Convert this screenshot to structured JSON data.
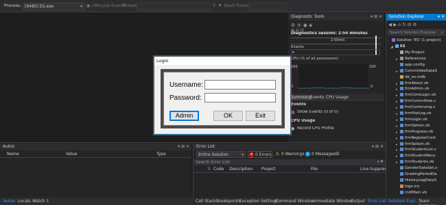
{
  "toolbar": {
    "process_label": "Process:",
    "process_value": "[9480] ES.exe",
    "lifecycle_label": "Lifecycle Events",
    "thread_label": "Thread:",
    "stack_frame_label": "Stack Frame:"
  },
  "diagnostic_tools": {
    "title": "Diagnostic Tools",
    "session_label": "Diagnostics session: 2:54 minutes",
    "timeline_label": "2:50min",
    "events_section": "Events",
    "cpu_section": "CPU (% of all processors)",
    "cpu_max_left": "100",
    "cpu_max_right": "100",
    "cpu_min_left": "0",
    "cpu_min_right": "0",
    "tabs": [
      "Summary",
      "Events",
      "CPU Usage"
    ],
    "events_heading": "Events",
    "show_events": "Show Events (0 of 0)",
    "cpu_usage_heading": "CPU Usage",
    "record_cpu": "Record CPU Profile"
  },
  "solution_explorer": {
    "title": "Solution Explorer",
    "search_placeholder": "Search Solution Explorer (",
    "solution": "Solution 'ES' (1 project)",
    "project": "ES",
    "items": [
      "My Project",
      "References",
      "app.config",
      "CommitteeDataS",
      "db_es.mdb",
      "frmAbout.vb",
      "frmAdmin.vb",
      "frmComLogin.vb",
      "frmCommittee.v",
      "frmContinuing.v",
      "frmHistLog.vb",
      "frmLogin.vb",
      "frmOption.vb",
      "frmProgress.vb",
      "frmRegisterCont",
      "frmSplash.vb",
      "frmStudentList.v",
      "frmStudentReco",
      "frmStudents.vb",
      "GenderDataSet.x",
      "GradingPeriodDa",
      "HistoryLogDataS",
      "logo.ico",
      "mdiMain.vb"
    ],
    "bottom_tabs": [
      "Solution Expl...",
      "Team Explorer"
    ]
  },
  "autos": {
    "title": "Autos",
    "columns": [
      "Name",
      "Value",
      "Type"
    ],
    "bottom_tabs": [
      "Autos",
      "Locals",
      "Watch 1"
    ]
  },
  "error_list": {
    "title": "Error List",
    "scope": "Entire Solution",
    "errors": "0 Errors",
    "warnings": "0 Warnings",
    "messages": "0 Messages",
    "search_placeholder": "Search Error List",
    "columns": [
      "Code",
      "Description",
      "Project",
      "File",
      "Line",
      "Suppres"
    ],
    "bottom_tabs": [
      "Call Stack",
      "Breakpoints",
      "Exception Settings",
      "Command Window",
      "Immediate Window",
      "Output",
      "Error List"
    ]
  },
  "login_dialog": {
    "title": "Login",
    "username_label": "Username:",
    "password_label": "Password:",
    "username_value": "",
    "password_value": "",
    "admin_button": "Admin",
    "ok_button": "OK",
    "exit_button": "Exit"
  },
  "colors": {
    "background": "#1e1e1e",
    "accent": "#007acc",
    "error_icon": "#e51400",
    "warning_icon": "#ffcc00",
    "message_icon": "#1ba1e2"
  }
}
